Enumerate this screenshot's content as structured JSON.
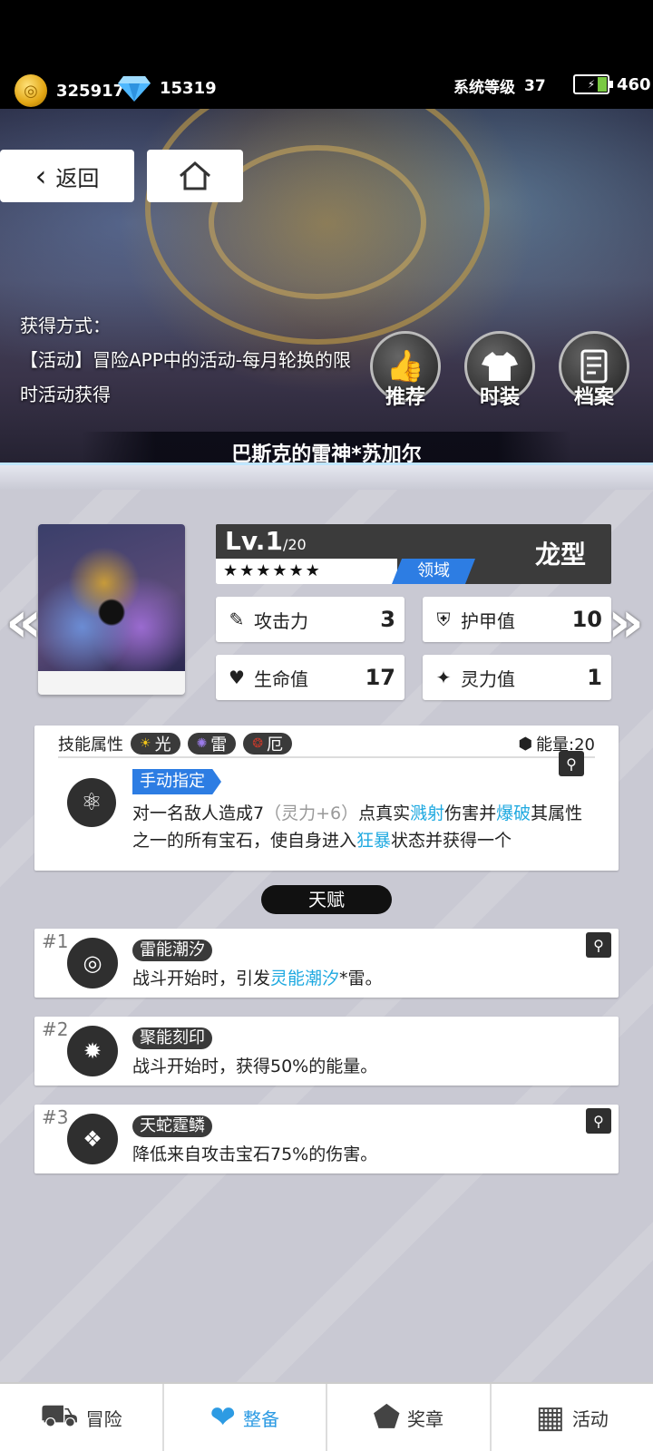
{
  "topbar": {
    "coins": "325917",
    "diamonds": "15319",
    "system_level_label": "系统等级",
    "system_level": "37",
    "energy": "460"
  },
  "hero": {
    "back_label": "返回",
    "acquire_title": "获得方式：",
    "acquire_text": "【活动】冒险APP中的活动-每月轮换的限时活动获得",
    "buttons": [
      {
        "label": "推荐",
        "icon": "thumbs-up-icon"
      },
      {
        "label": "时装",
        "icon": "shirt-icon"
      },
      {
        "label": "档案",
        "icon": "archive-icon"
      }
    ],
    "character_name": "巴斯克的雷神*苏加尔"
  },
  "character": {
    "level_prefix": "Lv.",
    "level": "1",
    "level_max": "/20",
    "stars": "★★★★★★",
    "domain": "领域",
    "type": "龙型",
    "stats": [
      {
        "label": "攻击力",
        "value": "3",
        "icon": "attack-icon"
      },
      {
        "label": "护甲值",
        "value": "10",
        "icon": "armor-icon"
      },
      {
        "label": "生命值",
        "value": "17",
        "icon": "health-icon"
      },
      {
        "label": "灵力值",
        "value": "1",
        "icon": "spirit-icon"
      }
    ]
  },
  "skill": {
    "attr_label": "技能属性",
    "attributes": [
      "光",
      "雷",
      "厄"
    ],
    "energy_label": "能量:20",
    "tag": "手动指定",
    "desc_1": "对一名敌人造成7",
    "desc_gray": "（灵力+6）",
    "desc_2": "点真实",
    "desc_hl_1": "溅射",
    "desc_3": "伤害并",
    "desc_hl_2": "爆破",
    "desc_4": "其属性之一的所有宝石，使自身进入",
    "desc_hl_3": "狂暴",
    "desc_5": "状态并获得一个"
  },
  "talent": {
    "header": "天赋",
    "items": [
      {
        "num": "#1",
        "name": "雷能潮汐",
        "desc_pre": "战斗开始时，引发",
        "desc_hl": "灵能潮汐",
        "desc_post": "*雷。"
      },
      {
        "num": "#2",
        "name": "聚能刻印",
        "desc_pre": "战斗开始时，获得50%的能量。",
        "desc_hl": "",
        "desc_post": ""
      },
      {
        "num": "#3",
        "name": "天蛇霆鳞",
        "desc_pre": "降低来自攻击宝石75%的伤害。",
        "desc_hl": "",
        "desc_post": ""
      }
    ]
  },
  "bottom_nav": [
    {
      "label": "冒险",
      "icon": "truck-icon"
    },
    {
      "label": "整备",
      "icon": "heart-gear-icon"
    },
    {
      "label": "奖章",
      "icon": "medal-icon"
    },
    {
      "label": "活动",
      "icon": "calendar-icon"
    }
  ],
  "colors": {
    "accent": "#2d7de3",
    "highlight": "#1fa9e0",
    "nav_active": "#2d9be3"
  }
}
